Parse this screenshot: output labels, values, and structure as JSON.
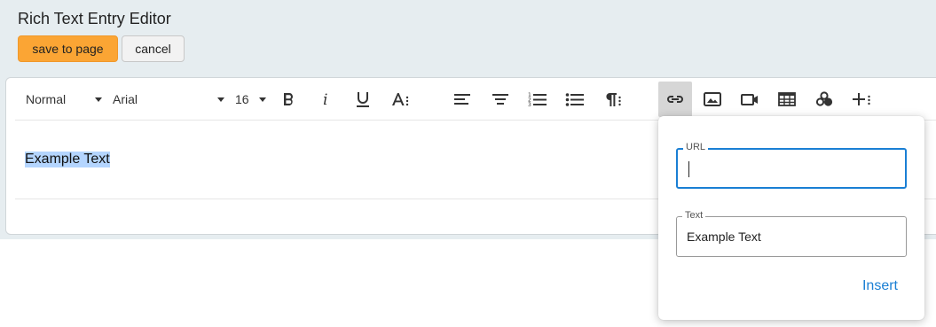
{
  "header": {
    "title": "Rich Text Entry Editor",
    "save_label": "save to page",
    "cancel_label": "cancel"
  },
  "toolbar": {
    "block_style": "Normal",
    "font_family": "Arial",
    "font_size": "16",
    "icons": [
      "bold-icon",
      "italic-icon",
      "underline-icon",
      "text-size-icon",
      "align-left-icon",
      "align-center-icon",
      "numbered-list-icon",
      "bulleted-list-icon",
      "paragraph-icon",
      "link-icon",
      "image-icon",
      "video-icon",
      "table-icon",
      "embed-icon",
      "more-insert-icon"
    ],
    "active_tool": "link-icon"
  },
  "content": {
    "text": "Example Text"
  },
  "link_popover": {
    "url_label": "URL",
    "url_value": "",
    "text_label": "Text",
    "text_value": "Example Text",
    "insert_label": "Insert"
  },
  "colors": {
    "header_bg": "#e6edf0",
    "save_button": "#fba534",
    "accent": "#1a7fd4",
    "selection": "#b4d5fe"
  }
}
